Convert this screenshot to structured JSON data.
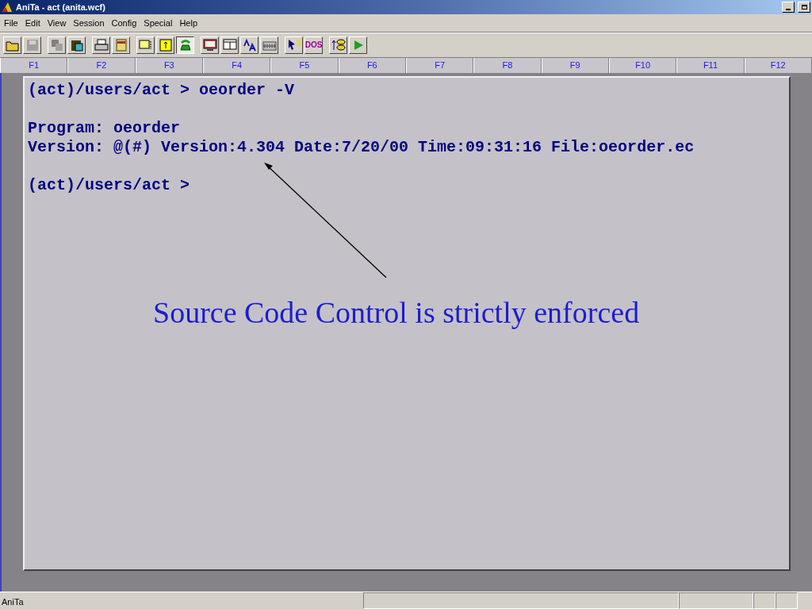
{
  "window": {
    "title": "AniTa -  act (anita.wcf)"
  },
  "menu": [
    "File",
    "Edit",
    "View",
    "Session",
    "Config",
    "Special",
    "Help"
  ],
  "toolbar": [
    [
      {
        "kind": "open",
        "pressed": false
      },
      {
        "kind": "save",
        "pressed": false
      }
    ],
    [
      {
        "kind": "copy",
        "pressed": false
      },
      {
        "kind": "paste",
        "pressed": false
      }
    ],
    [
      {
        "kind": "print",
        "pressed": false
      },
      {
        "kind": "document",
        "pressed": false
      }
    ],
    [
      {
        "kind": "frame",
        "pressed": false
      },
      {
        "kind": "scroll",
        "pressed": false
      },
      {
        "kind": "phone",
        "pressed": true
      }
    ],
    [
      {
        "kind": "screen",
        "pressed": false
      },
      {
        "kind": "window",
        "pressed": false
      },
      {
        "kind": "font",
        "pressed": false
      },
      {
        "kind": "keyboard",
        "pressed": false
      }
    ],
    [
      {
        "kind": "help",
        "pressed": false
      },
      {
        "kind": "dos",
        "pressed": false,
        "label": "DOS"
      }
    ],
    [
      {
        "kind": "database",
        "pressed": false
      },
      {
        "kind": "play",
        "pressed": false
      }
    ]
  ],
  "function_keys": [
    "F1",
    "F2",
    "F3",
    "F4",
    "F5",
    "F6",
    "F7",
    "F8",
    "F9",
    "F10",
    "F11",
    "F12"
  ],
  "terminal": {
    "blocks": [
      [
        "(act)/users/act > oeorder -V"
      ],
      [
        "Program: oeorder",
        "Version: @(#) Version:4.304 Date:7/20/00 Time:09:31:16 File:oeorder.ec"
      ],
      [
        "(act)/users/act >"
      ]
    ]
  },
  "annotation": {
    "text": "Source Code Control is strictly enforced"
  },
  "status_bar": {
    "text": "AniTa"
  }
}
